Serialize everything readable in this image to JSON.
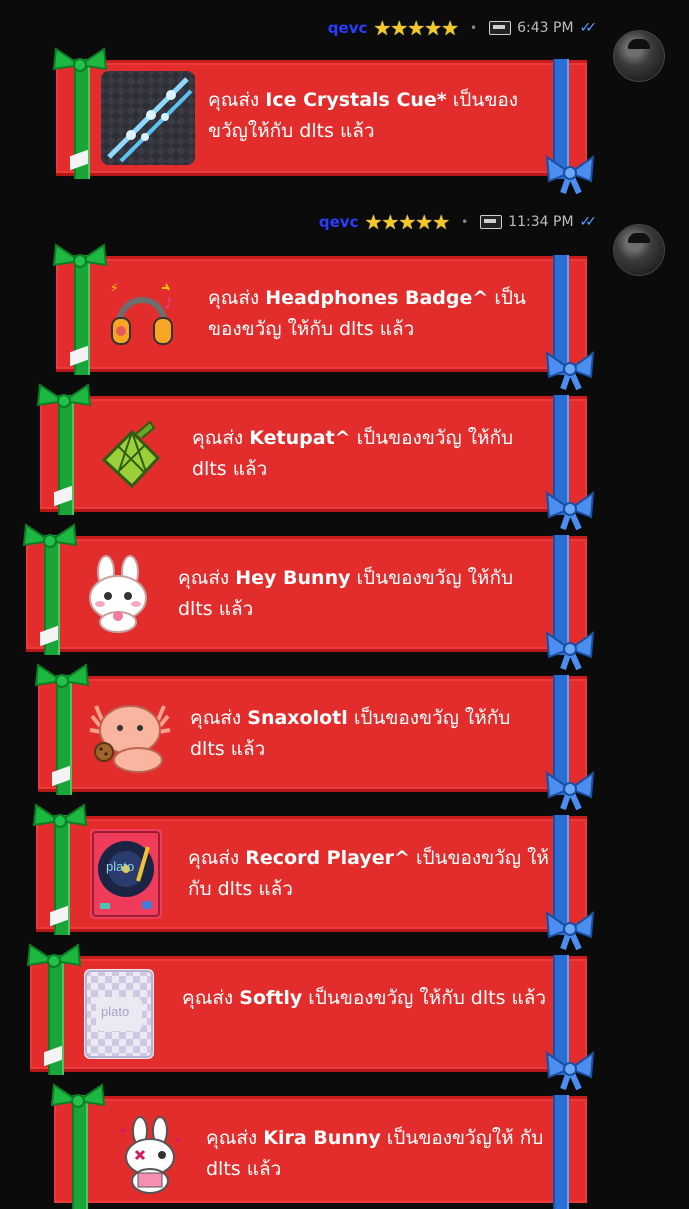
{
  "headers": [
    {
      "user": "qevc",
      "stars": "★★★★★",
      "time": "6:43 PM"
    },
    {
      "user": "qevc",
      "stars": "★★★★★",
      "time": "11:34 PM"
    }
  ],
  "cards": [
    {
      "prefix": "คุณส่ง ",
      "gift": "Ice Crystals Cue*",
      "suffix": " เป็นของขวัญให้กับ dlts แล้ว",
      "icon": "ice-cue-icon"
    },
    {
      "prefix": "คุณส่ง ",
      "gift": "Headphones Badge^",
      "suffix": " เป็นของขวัญ ให้กับ dlts แล้ว",
      "icon": "headphones-icon"
    },
    {
      "prefix": "คุณส่ง ",
      "gift": "Ketupat^",
      "suffix": " เป็นของขวัญ ให้กับ dlts แล้ว",
      "icon": "ketupat-icon"
    },
    {
      "prefix": "คุณส่ง ",
      "gift": "Hey Bunny",
      "suffix": " เป็นของขวัญ ให้กับ dlts แล้ว",
      "icon": "bunny-icon"
    },
    {
      "prefix": "คุณส่ง ",
      "gift": "Snaxolotl",
      "suffix": " เป็นของขวัญ ให้กับ dlts แล้ว",
      "icon": "axolotl-icon"
    },
    {
      "prefix": "คุณส่ง ",
      "gift": "Record Player^",
      "suffix": " เป็นของขวัญ ให้กับ dlts แล้ว",
      "icon": "record-player-icon"
    },
    {
      "prefix": "คุณส่ง ",
      "gift": "Softly",
      "suffix": " เป็นของขวัญ ให้กับ dlts แล้ว",
      "icon": "softly-card-icon"
    },
    {
      "prefix": "คุณส่ง ",
      "gift": "Kira Bunny",
      "suffix": " เป็นของขวัญให้ กับ dlts แล้ว",
      "icon": "kira-bunny-icon"
    }
  ],
  "thumb_text": {
    "record": "plato",
    "softly": "plato"
  },
  "colors": {
    "card": "#e32d2d",
    "ribbon_green": "#1aa53a",
    "ribbon_blue": "#2a6fd6",
    "username": "#2a3cff",
    "star": "#f5c825"
  }
}
